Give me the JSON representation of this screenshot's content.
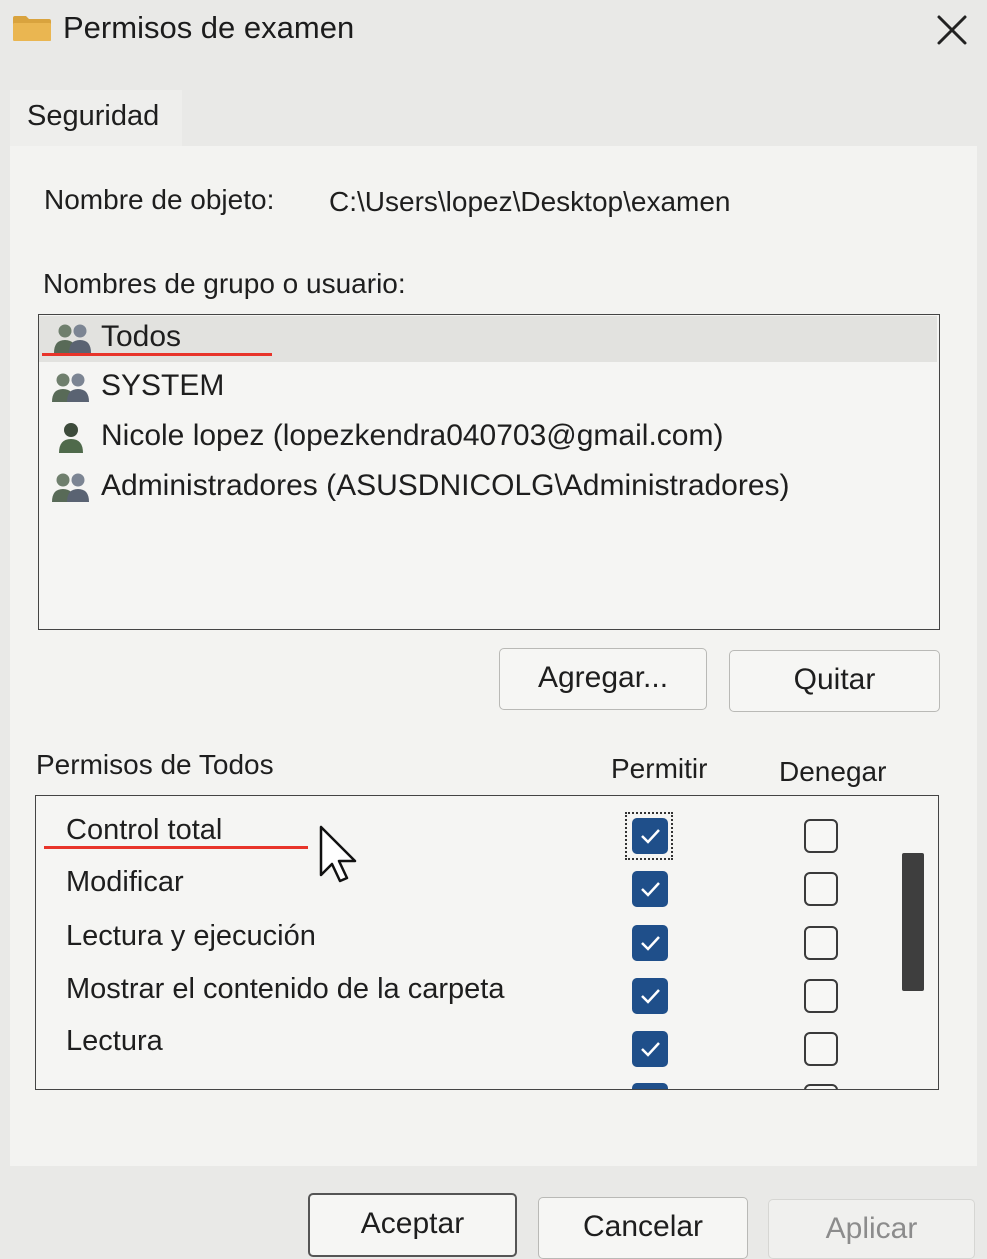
{
  "window": {
    "title": "Permisos de examen",
    "icon": "folder-icon",
    "close_icon": "close-icon"
  },
  "tabs": [
    {
      "label": "Seguridad",
      "selected": true
    }
  ],
  "object": {
    "label": "Nombre de objeto:",
    "value": "C:\\Users\\lopez\\Desktop\\examen"
  },
  "users": {
    "label": "Nombres de grupo o usuario:",
    "items": [
      {
        "name": "Todos",
        "icon": "group-icon",
        "selected": true
      },
      {
        "name": "SYSTEM",
        "icon": "group-icon",
        "selected": false
      },
      {
        "name": "Nicole lopez (lopezkendra040703@gmail.com)",
        "icon": "user-icon",
        "selected": false
      },
      {
        "name": "Administradores (ASUSDNICOLG\\Administradores)",
        "icon": "group-icon",
        "selected": false
      }
    ]
  },
  "buttons": {
    "add": "Agregar...",
    "remove": "Quitar",
    "ok": "Aceptar",
    "cancel": "Cancelar",
    "apply": "Aplicar"
  },
  "permissions": {
    "label": "Permisos de Todos",
    "allow_header": "Permitir",
    "deny_header": "Denegar",
    "items": [
      {
        "name": "Control total",
        "allow": true,
        "deny": false
      },
      {
        "name": "Modificar",
        "allow": true,
        "deny": false
      },
      {
        "name": "Lectura y ejecución",
        "allow": true,
        "deny": false
      },
      {
        "name": "Mostrar el contenido de la carpeta",
        "allow": true,
        "deny": false
      },
      {
        "name": "Lectura",
        "allow": true,
        "deny": false
      }
    ]
  },
  "colors": {
    "checkbox_checked": "#1f4f8a",
    "annotation_red": "#e8342a",
    "window_bg": "#f3f3f1"
  }
}
